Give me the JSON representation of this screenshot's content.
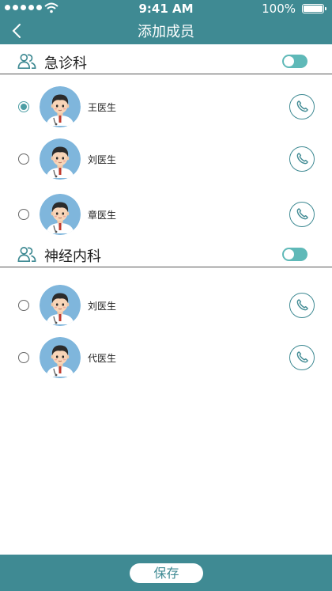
{
  "status_bar": {
    "time": "9:41 AM",
    "battery": "100%"
  },
  "nav": {
    "title": "添加成员",
    "back_icon": "chevron-left-icon"
  },
  "colors": {
    "primary": "#3f8a93",
    "accent": "#5fb9b8",
    "radio": "#4d9ea4"
  },
  "groups": [
    {
      "name": "急诊科",
      "toggle_on": true,
      "members": [
        {
          "name": "王医生",
          "selected": true
        },
        {
          "name": "刘医生",
          "selected": false
        },
        {
          "name": "章医生",
          "selected": false
        }
      ]
    },
    {
      "name": "神经内科",
      "toggle_on": true,
      "members": [
        {
          "name": "刘医生",
          "selected": false
        },
        {
          "name": "代医生",
          "selected": false
        }
      ]
    }
  ],
  "footer": {
    "save_label": "保存"
  }
}
